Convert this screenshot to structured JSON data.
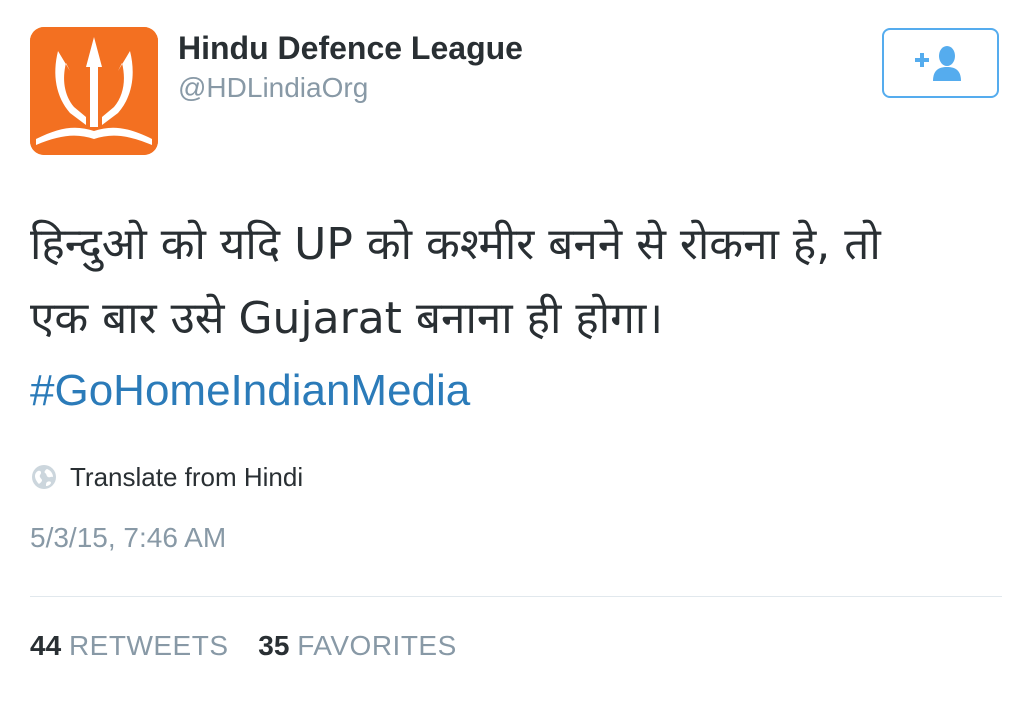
{
  "profile": {
    "display_name": "Hindu Defence League",
    "handle": "@HDLindiaOrg",
    "avatar_icon": "trident-logo-icon",
    "avatar_color": "#f37021"
  },
  "follow_button": {
    "icon": "add-user-icon",
    "accent_color": "#55acee"
  },
  "tweet": {
    "text_lines": [
      "हिन्दुओ को यदि UP को कश्मीर बनने से रोकना हे, तो",
      "एक बार उसे Gujarat बनाना ही होगा।"
    ],
    "hashtag": "#GoHomeIndianMedia",
    "translate_label": "Translate from Hindi",
    "translate_icon": "globe-icon",
    "timestamp": "5/3/15, 7:46 AM"
  },
  "stats": {
    "retweets_count": "44",
    "retweets_label": "RETWEETS",
    "favorites_count": "35",
    "favorites_label": "FAVORITES"
  }
}
